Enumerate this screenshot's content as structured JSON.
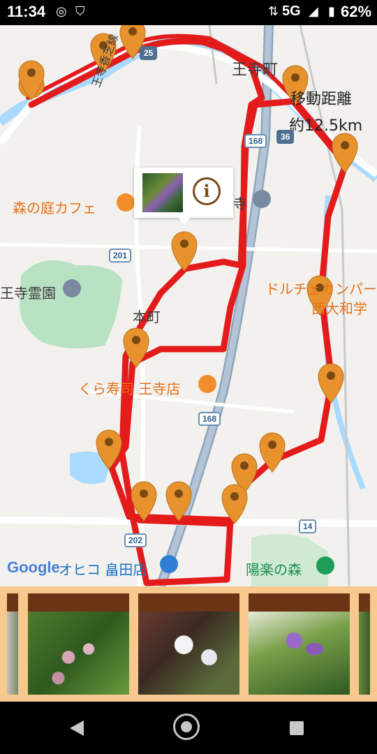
{
  "status_bar": {
    "time": "11:34",
    "network": "5G",
    "battery": "62%"
  },
  "map": {
    "labels": {
      "cafe": "森の庭カフェ",
      "temple": "寺",
      "road_name": "王寺香芝線",
      "area_ouji": "王寺町",
      "cemetery": "王寺霊園",
      "honmachi": "本町",
      "sushi": "くら寿司 王寺店",
      "dolce": "ドルチェカンパー",
      "yamato": "西大和学",
      "supermarket": "オヒコ 畠田店",
      "forest": "陽楽の森"
    },
    "route": {
      "distance_label": "移動距離",
      "distance_value": "約12.5km"
    },
    "shields": {
      "r25": "25",
      "r168a": "168",
      "r36": "36",
      "r201": "201",
      "r168b": "168",
      "r202": "202",
      "r14": "14"
    },
    "popup": {
      "info_glyph": "i"
    },
    "attribution": "Google",
    "accent_color": "#e31b1b",
    "pin_color": "#e8922e"
  },
  "photo_strip": {
    "cards": [
      {
        "name": "partial-left"
      },
      {
        "name": "pink-buds"
      },
      {
        "name": "white-flowers"
      },
      {
        "name": "purple-spikes"
      },
      {
        "name": "partial-right"
      }
    ]
  }
}
